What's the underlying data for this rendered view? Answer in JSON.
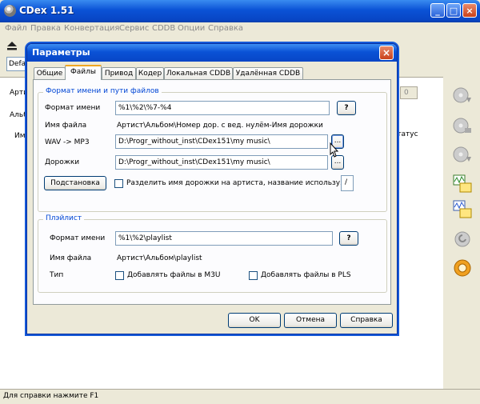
{
  "app": {
    "title": "CDex 1.51",
    "menu": [
      "Файл",
      "Правка",
      "Конвертация",
      "Сервис",
      "CDDB",
      "Опции",
      "Справка"
    ],
    "combo_value": "Defa",
    "side_labels": [
      "Арти",
      "Альб",
      "Им"
    ],
    "status_column": "Статус",
    "small_field_value": "0",
    "status_bar": "Для справки нажмите F1"
  },
  "dialog": {
    "title": "Параметры",
    "tabs": [
      "Общие",
      "Файлы",
      "Привод",
      "Кодер",
      "Локальная CDDB",
      "Удалённая CDDB"
    ],
    "active_tab_index": 1,
    "group_files": {
      "title": "Формат имени и пути файлов",
      "format_label": "Формат имени",
      "format_value": "%1\\%2\\%7-%4",
      "help_label": "?",
      "filename_label": "Имя файла",
      "filename_value": "Артист\\Альбом\\Номер дор. с вед. нулём-Имя дорожки",
      "wav_label": "WAV -> MP3",
      "wav_value": "D:\\Progr_without_inst\\CDex151\\my music\\",
      "tracks_label": "Дорожки",
      "tracks_value": "D:\\Progr_without_inst\\CDex151\\my music\\",
      "browse_label": "...",
      "substitute_label": "Подстановка",
      "split_label": "Разделить имя дорожки на артиста, название используя:",
      "split_value": "/"
    },
    "group_playlist": {
      "title": "Плэйлист",
      "format_label": "Формат имени",
      "format_value": "%1\\%2\\playlist",
      "help_label": "?",
      "filename_label": "Имя файла",
      "filename_value": "Артист\\Альбом\\playlist",
      "type_label": "Тип",
      "m3u_label": "Добавлять файлы в M3U",
      "pls_label": "Добавлять файлы в PLS"
    },
    "buttons": {
      "ok": "OK",
      "cancel": "Отмена",
      "help": "Справка"
    }
  }
}
